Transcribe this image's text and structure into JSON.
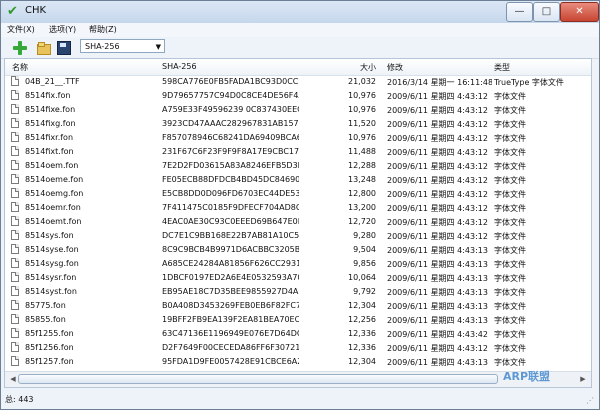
{
  "window": {
    "title": "CHK",
    "controls": [
      "—",
      "□",
      "✕"
    ]
  },
  "menu": [
    "文件(X)",
    "选项(Y)",
    "帮助(Z)"
  ],
  "toolbar": {
    "hash_option": "SHA-256",
    "dropdown_arrow": "▼"
  },
  "table": {
    "headers": {
      "name": "名称",
      "hash": "SHA-256",
      "size": "大小",
      "modified": "修改",
      "type": "类型"
    },
    "rows": [
      {
        "name": "04B_21__.TTF",
        "hash": "598CA776E0FB5FADA1BC93D0CC...",
        "size": "21,032",
        "modified": "2016/3/14 星期一 16:11:48",
        "type": "TrueType 字体文件"
      },
      {
        "name": "8514fix.fon",
        "hash": "9D79657757C94D0C8CE4DE56F4A...",
        "size": "10,976",
        "modified": "2009/6/11 星期四 4:43:12",
        "type": "字体文件"
      },
      {
        "name": "8514fixe.fon",
        "hash": "A759E33F49596239 0C837430EECF...",
        "size": "10,976",
        "modified": "2009/6/11 星期四 4:43:12",
        "type": "字体文件"
      },
      {
        "name": "8514fixg.fon",
        "hash": "3923CD47AAAC282967831AB1571...",
        "size": "11,520",
        "modified": "2009/6/11 星期四 4:43:12",
        "type": "字体文件"
      },
      {
        "name": "8514fixr.fon",
        "hash": "F857078946C68241DA69409BCA6...",
        "size": "10,976",
        "modified": "2009/6/11 星期四 4:43:12",
        "type": "字体文件"
      },
      {
        "name": "8514fixt.fon",
        "hash": "231F67C6F23F9F9F8A17E9CBC173...",
        "size": "11,488",
        "modified": "2009/6/11 星期四 4:43:12",
        "type": "字体文件"
      },
      {
        "name": "8514oem.fon",
        "hash": "7E2D2FD03615A83A8246EFB5D3D...",
        "size": "12,288",
        "modified": "2009/6/11 星期四 4:43:12",
        "type": "字体文件"
      },
      {
        "name": "8514oeme.fon",
        "hash": "FE05ECB88DFDCB4BD45DC84690...",
        "size": "13,248",
        "modified": "2009/6/11 星期四 4:43:12",
        "type": "字体文件"
      },
      {
        "name": "8514oemg.fon",
        "hash": "E5CB8DD0D096FD6703EC44DE539...",
        "size": "12,800",
        "modified": "2009/6/11 星期四 4:43:12",
        "type": "字体文件"
      },
      {
        "name": "8514oemr.fon",
        "hash": "7F411475C0185F9DFECF704AD8C...",
        "size": "13,200",
        "modified": "2009/6/11 星期四 4:43:12",
        "type": "字体文件"
      },
      {
        "name": "8514oemt.fon",
        "hash": "4EAC0AE30C93C0EEED69B647E0D...",
        "size": "12,720",
        "modified": "2009/6/11 星期四 4:43:12",
        "type": "字体文件"
      },
      {
        "name": "8514sys.fon",
        "hash": "DC7E1C9BB168E22B7AB81A10C5...",
        "size": "9,280",
        "modified": "2009/6/11 星期四 4:43:12",
        "type": "字体文件"
      },
      {
        "name": "8514syse.fon",
        "hash": "8C9C9BCB4B9971D6ACBBC3205B...",
        "size": "9,504",
        "modified": "2009/6/11 星期四 4:43:13",
        "type": "字体文件"
      },
      {
        "name": "8514sysg.fon",
        "hash": "A685CE24284A81856F626CC2931...",
        "size": "9,856",
        "modified": "2009/6/11 星期四 4:43:13",
        "type": "字体文件"
      },
      {
        "name": "8514sysr.fon",
        "hash": "1DBCF0197ED2A6E4E0532593A70...",
        "size": "10,064",
        "modified": "2009/6/11 星期四 4:43:13",
        "type": "字体文件"
      },
      {
        "name": "8514syst.fon",
        "hash": "EB95AE18C7D35BEE9855927D4A6...",
        "size": "9,792",
        "modified": "2009/6/11 星期四 4:43:13",
        "type": "字体文件"
      },
      {
        "name": "85775.fon",
        "hash": "B0A408D3453269FEB0EB6F82FC70...",
        "size": "12,304",
        "modified": "2009/6/11 星期四 4:43:13",
        "type": "字体文件"
      },
      {
        "name": "85855.fon",
        "hash": "19BFF2FB9EA139F2EA81BEA70EC...",
        "size": "12,256",
        "modified": "2009/6/11 星期四 4:43:13",
        "type": "字体文件"
      },
      {
        "name": "85f1255.fon",
        "hash": "63C47136E1196949E076E7D64DC...",
        "size": "12,336",
        "modified": "2009/6/11 星期四 4:43:42",
        "type": "字体文件"
      },
      {
        "name": "85f1256.fon",
        "hash": "D2F7649F00CECEDA86FF6F30721...",
        "size": "12,336",
        "modified": "2009/6/11 星期四 4:43:12",
        "type": "字体文件"
      },
      {
        "name": "85f1257.fon",
        "hash": "95FDA1D9FE0057428E91CBCE6A2...",
        "size": "12,304",
        "modified": "2009/6/11 星期四 4:43:13",
        "type": "字体文件"
      }
    ]
  },
  "status": {
    "text": "总: 443"
  },
  "watermark": "ARP联盟 arpun.com",
  "icons": [
    "check-icon",
    "add-icon",
    "folder-icon",
    "save-icon",
    "file-icon"
  ]
}
